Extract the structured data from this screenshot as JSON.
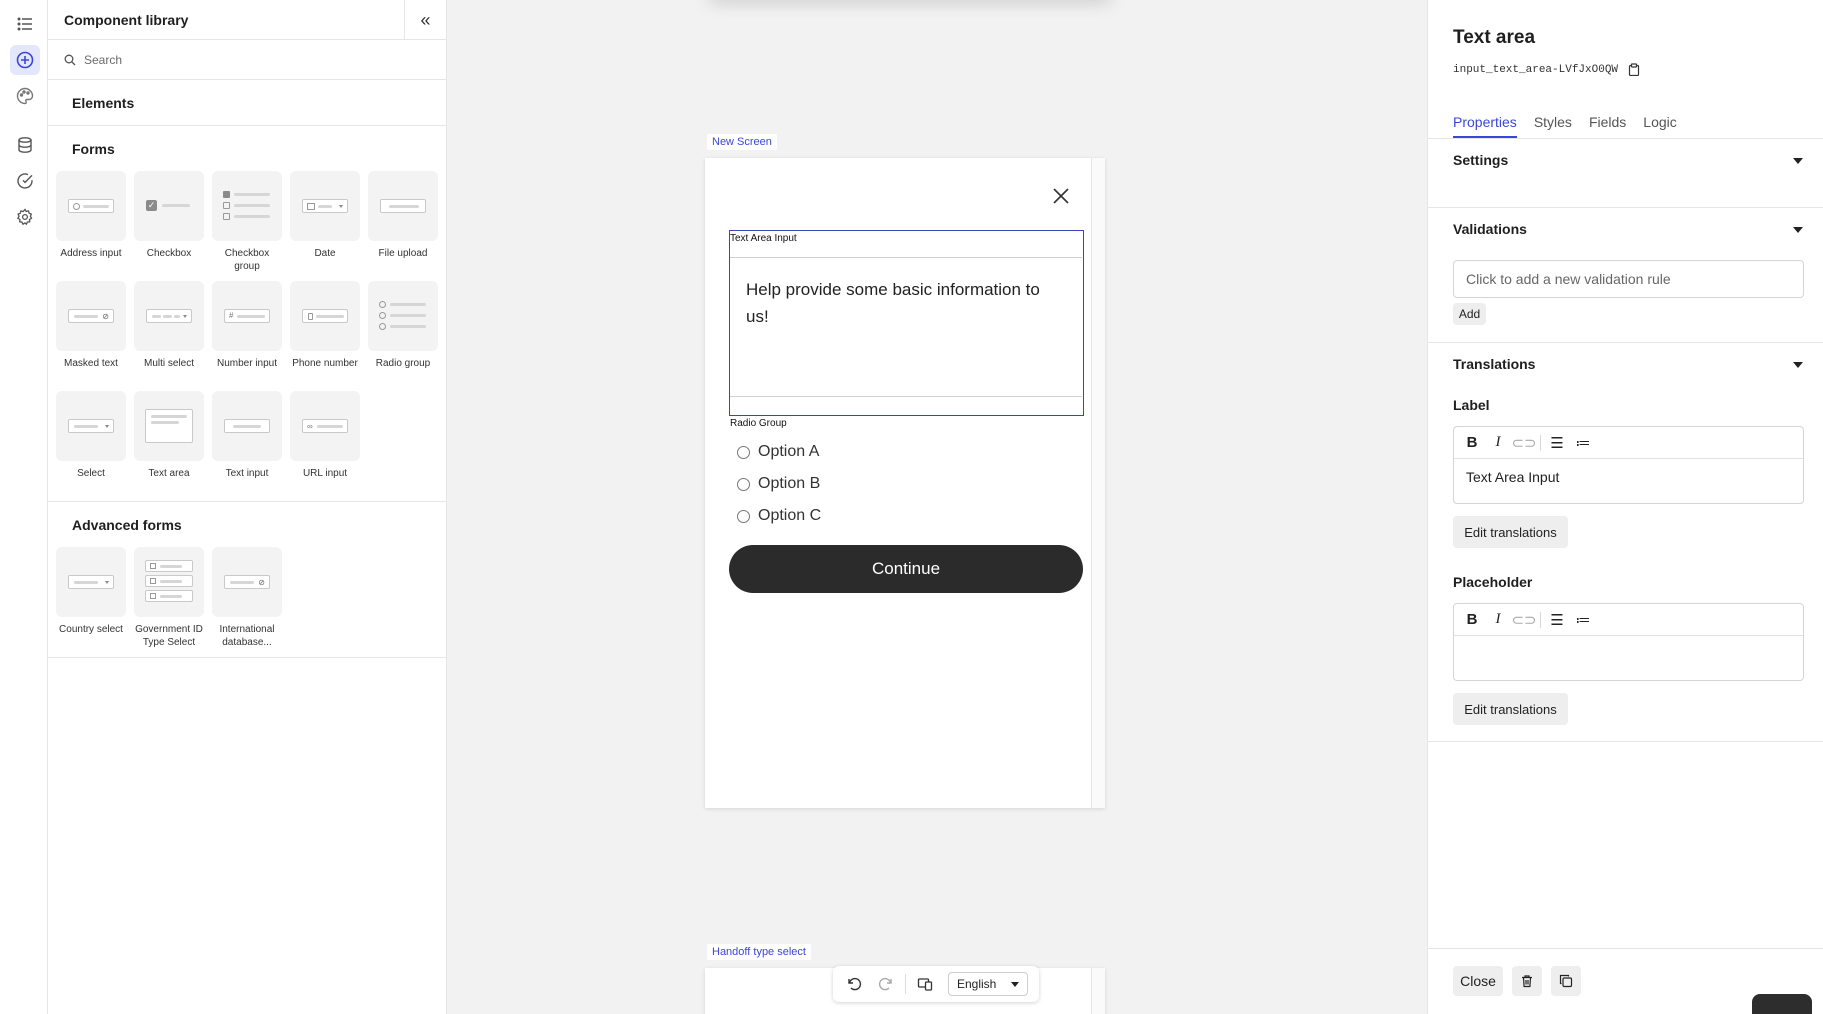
{
  "library": {
    "title": "Component library",
    "search_placeholder": "Search",
    "elements_title": "Elements",
    "forms_title": "Forms",
    "forms": [
      {
        "label": "Address input",
        "icon": "address-input-icon"
      },
      {
        "label": "Checkbox",
        "icon": "checkbox-icon"
      },
      {
        "label": "Checkbox group",
        "icon": "checkbox-group-icon"
      },
      {
        "label": "Date",
        "icon": "date-icon"
      },
      {
        "label": "File upload",
        "icon": "file-upload-icon"
      },
      {
        "label": "Masked text",
        "icon": "masked-text-icon"
      },
      {
        "label": "Multi select",
        "icon": "multi-select-icon"
      },
      {
        "label": "Number input",
        "icon": "number-input-icon"
      },
      {
        "label": "Phone number",
        "icon": "phone-number-icon"
      },
      {
        "label": "Radio group",
        "icon": "radio-group-icon"
      },
      {
        "label": "Select",
        "icon": "select-icon"
      },
      {
        "label": "Text area",
        "icon": "text-area-icon"
      },
      {
        "label": "Text input",
        "icon": "text-input-icon"
      },
      {
        "label": "URL input",
        "icon": "url-input-icon"
      }
    ],
    "advanced_title": "Advanced forms",
    "advanced": [
      {
        "label": "Country select",
        "icon": "country-select-icon"
      },
      {
        "label": "Government ID Type Select",
        "icon": "government-id-icon"
      },
      {
        "label": "International database...",
        "icon": "international-database-icon"
      }
    ]
  },
  "canvas": {
    "screen1_label": "New Screen",
    "text_area_label": "Text Area Input",
    "text_area_value": "Help provide some basic information to us!",
    "radio_group_label": "Radio Group",
    "radio_options": [
      "Option A",
      "Option B",
      "Option C"
    ],
    "continue_label": "Continue",
    "screen2_label": "Handoff type select",
    "language": "English"
  },
  "props": {
    "title": "Text area",
    "id": "input_text_area-LVfJxO0QW",
    "tabs": [
      "Properties",
      "Styles",
      "Fields",
      "Logic"
    ],
    "active_tab": "Properties",
    "settings_title": "Settings",
    "validations_title": "Validations",
    "validation_placeholder": "Click to add a new validation rule",
    "add_label": "Add",
    "translations_title": "Translations",
    "label_title": "Label",
    "label_value": "Text Area Input",
    "edit_translations": "Edit translations",
    "placeholder_title": "Placeholder",
    "placeholder_value": "",
    "close_label": "Close"
  },
  "colors": {
    "accent": "#3b46d6",
    "selection_border": "#3b46b8",
    "primary_button": "#2b2b2b"
  }
}
